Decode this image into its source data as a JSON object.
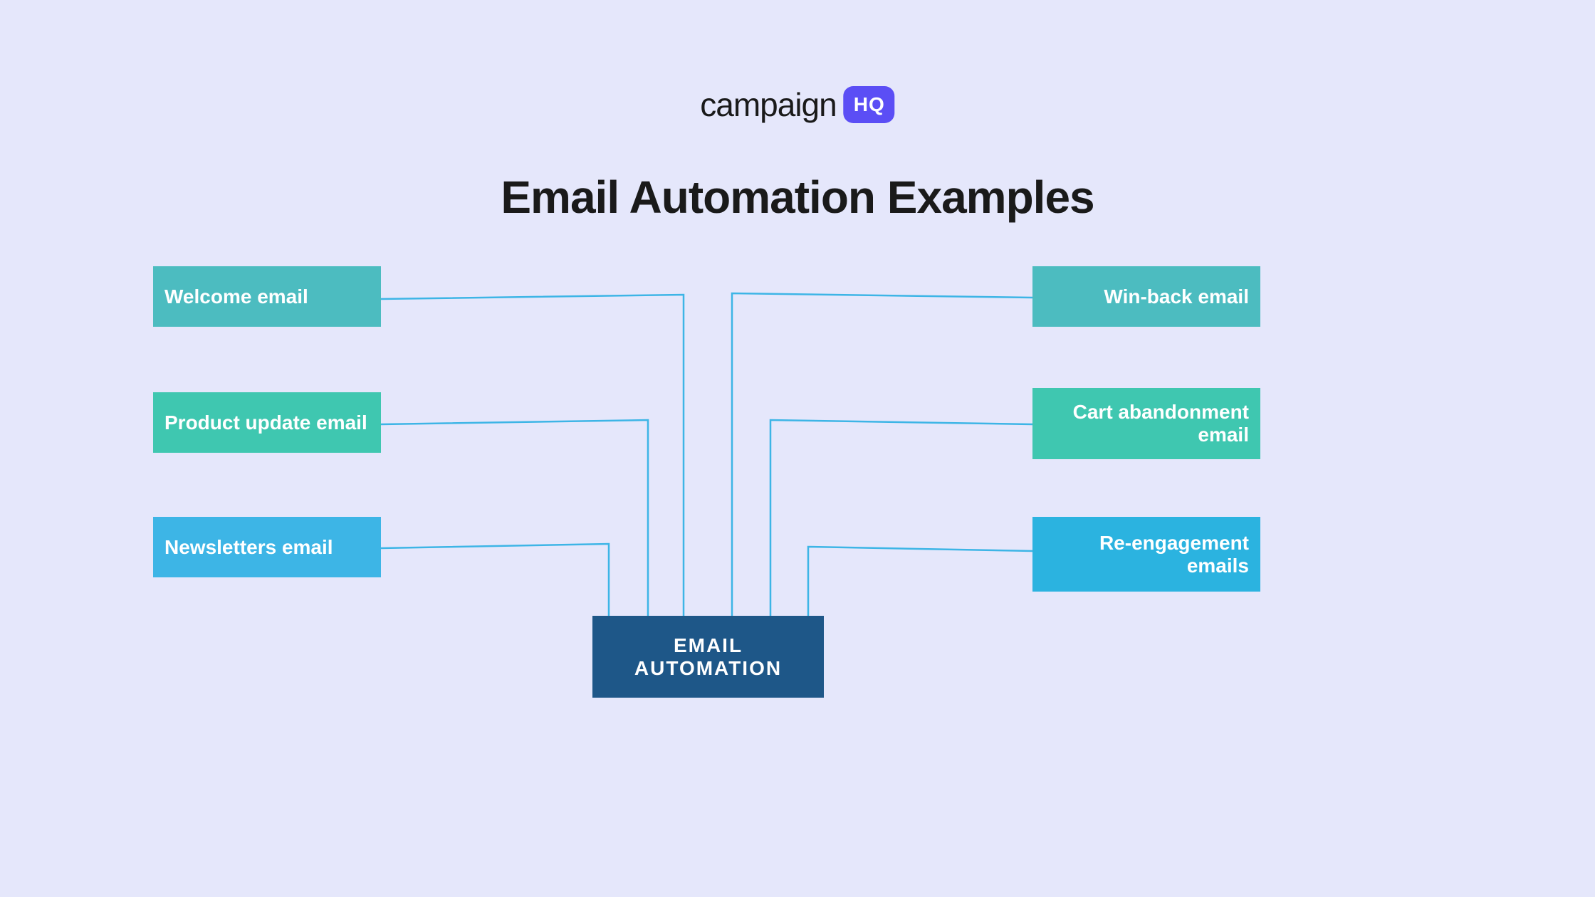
{
  "logo": {
    "text": "campaign",
    "badge": "HQ"
  },
  "title": "Email Automation Examples",
  "center": {
    "label": "EMAIL AUTOMATION"
  },
  "left_boxes": [
    {
      "label": "Welcome email"
    },
    {
      "label": "Product update email"
    },
    {
      "label": "Newsletters email"
    }
  ],
  "right_boxes": [
    {
      "label": "Win-back email"
    },
    {
      "label": "Cart abandonment email"
    },
    {
      "label": "Re-engagement emails"
    }
  ],
  "colors": {
    "background": "#e5e7fb",
    "teal_med": "#4cbcc0",
    "teal_light": "#3fc7b0",
    "blue_light": "#3db5e6",
    "navy": "#1e5788",
    "badge": "#5b4ef5"
  }
}
